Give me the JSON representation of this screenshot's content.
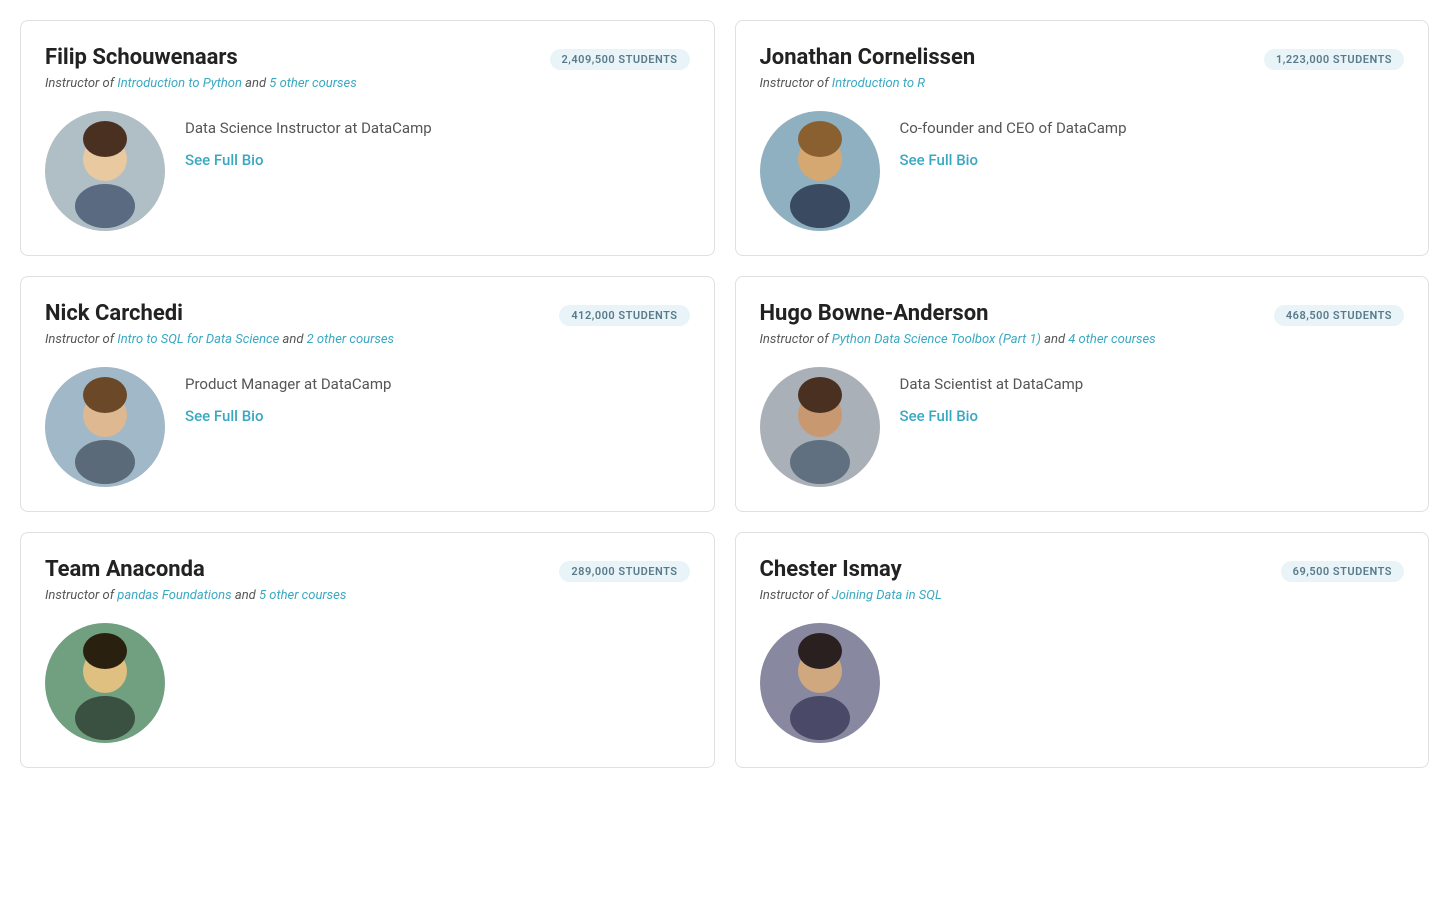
{
  "instructors": [
    {
      "id": "filip",
      "name": "Filip Schouwenaars",
      "students": "2,409,500 STUDENTS",
      "instructor_of_prefix": "Instructor of ",
      "course_link_text": "Introduction to Python",
      "course_link": "#",
      "other_courses_text": " and ",
      "other_courses_link": "5 other courses",
      "other_courses_href": "#",
      "job_title": "Data Science Instructor at DataCamp",
      "see_bio_label": "See Full Bio",
      "avatar_color1": "#7a8fa6",
      "avatar_color2": "#5a7090"
    },
    {
      "id": "jonathan",
      "name": "Jonathan Cornelissen",
      "students": "1,223,000 STUDENTS",
      "instructor_of_prefix": "Instructor of ",
      "course_link_text": "Introduction to R",
      "course_link": "#",
      "other_courses_text": "",
      "other_courses_link": "",
      "other_courses_href": "#",
      "job_title": "Co-founder and CEO of DataCamp",
      "see_bio_label": "See Full Bio",
      "avatar_color1": "#8a7a6a",
      "avatar_color2": "#6a5a4a"
    },
    {
      "id": "nick",
      "name": "Nick Carchedi",
      "students": "412,000 STUDENTS",
      "instructor_of_prefix": "Instructor of ",
      "course_link_text": "Intro to SQL for Data Science",
      "course_link": "#",
      "other_courses_text": " and ",
      "other_courses_link": "2 other courses",
      "other_courses_href": "#",
      "job_title": "Product Manager at DataCamp",
      "see_bio_label": "See Full Bio",
      "avatar_color1": "#7a8a7a",
      "avatar_color2": "#5a6a5a"
    },
    {
      "id": "hugo",
      "name": "Hugo Bowne-Anderson",
      "students": "468,500 STUDENTS",
      "instructor_of_prefix": "Instructor of ",
      "course_link_text": "Python Data Science Toolbox (Part 1)",
      "course_link": "#",
      "other_courses_text": " and ",
      "other_courses_link": "4 other courses",
      "other_courses_href": "#",
      "job_title": "Data Scientist at DataCamp",
      "see_bio_label": "See Full Bio",
      "avatar_color1": "#8a8a8a",
      "avatar_color2": "#6a6a6a"
    },
    {
      "id": "anaconda",
      "name": "Team Anaconda",
      "students": "289,000 STUDENTS",
      "instructor_of_prefix": "Instructor of ",
      "course_link_text": "pandas Foundations",
      "course_link": "#",
      "other_courses_text": " and ",
      "other_courses_link": "5 other courses",
      "other_courses_href": "#",
      "job_title": "",
      "see_bio_label": "",
      "avatar_color1": "#5a8a6a",
      "avatar_color2": "#3a6a4a"
    },
    {
      "id": "chester",
      "name": "Chester Ismay",
      "students": "69,500 STUDENTS",
      "instructor_of_prefix": "Instructor of ",
      "course_link_text": "Joining Data in SQL",
      "course_link": "#",
      "other_courses_text": "",
      "other_courses_link": "",
      "other_courses_href": "#",
      "job_title": "",
      "see_bio_label": "",
      "avatar_color1": "#7a7a8a",
      "avatar_color2": "#5a5a6a"
    }
  ],
  "avatars": {
    "filip": {
      "bg": "#b0bec5",
      "face": "#f5c5a0"
    },
    "jonathan": {
      "bg": "#90a4ae",
      "face": "#d4a070"
    },
    "nick": {
      "bg": "#a5c4d4",
      "face": "#e0b090"
    },
    "hugo": {
      "bg": "#b0b8c0",
      "face": "#c09070"
    },
    "anaconda": {
      "bg": "#80b090",
      "face": "#e0c080"
    },
    "chester": {
      "bg": "#9090a8",
      "face": "#d0a880"
    }
  }
}
